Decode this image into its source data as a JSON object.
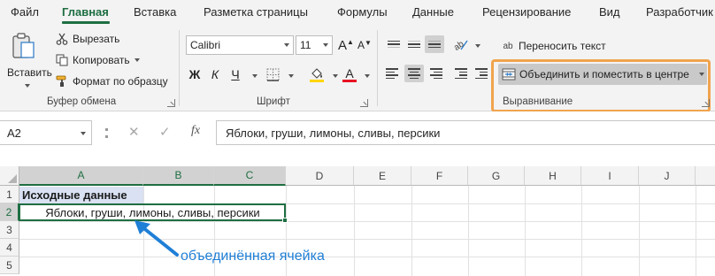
{
  "tabs": [
    {
      "label": "Файл",
      "active": false
    },
    {
      "label": "Главная",
      "active": true
    },
    {
      "label": "Вставка",
      "active": false
    },
    {
      "label": "Разметка страницы",
      "active": false
    },
    {
      "label": "Формулы",
      "active": false
    },
    {
      "label": "Данные",
      "active": false
    },
    {
      "label": "Рецензирование",
      "active": false
    },
    {
      "label": "Вид",
      "active": false
    },
    {
      "label": "Разработчик",
      "active": false
    }
  ],
  "clipboard": {
    "paste_label": "Вставить",
    "cut_label": "Вырезать",
    "copy_label": "Копировать",
    "format_painter_label": "Формат по образцу",
    "group_label": "Буфер обмена"
  },
  "font": {
    "font_name": "Calibri",
    "font_size": "11",
    "group_label": "Шрифт",
    "grow_label": "A",
    "shrink_label": "A",
    "bold_label": "Ж",
    "italic_label": "К",
    "underline_label": "Ч",
    "font_color_label": "A"
  },
  "alignment": {
    "wrap_text_label": "Переносить текст",
    "merge_center_label": "Объединить и поместить в центре",
    "group_label": "Выравнивание"
  },
  "formula_bar": {
    "name_box": "A2",
    "fx_label": "fx",
    "formula": "Яблоки, груши, лимоны, сливы, персики"
  },
  "sheet": {
    "columns": [
      "A",
      "B",
      "C",
      "D",
      "E",
      "F",
      "G",
      "H",
      "I",
      "J"
    ],
    "rows": [
      "1",
      "2",
      "3",
      "4",
      "5"
    ],
    "a1": "Исходные данные",
    "merged_a2": "Яблоки, груши, лимоны, сливы, персики"
  },
  "annotation": {
    "text": "объединённая ячейка"
  },
  "colors": {
    "accent_green": "#1e6e42",
    "highlight_orange": "#f0a44e",
    "annotation_blue": "#1f7fd6",
    "header_fill": "#d9e1f2"
  }
}
